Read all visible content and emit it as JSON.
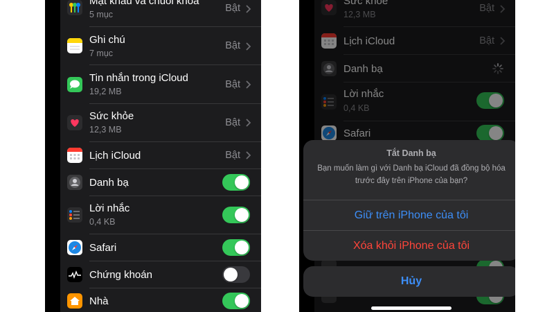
{
  "status_on_label": "Bật",
  "left_screen": {
    "rows": [
      {
        "title": "Mật khẩu và chuỗi khóa",
        "subtitle": "5 mục",
        "status": "Bật"
      },
      {
        "title": "Ghi chú",
        "subtitle": "7 mục",
        "status": "Bật"
      },
      {
        "title": "Tin nhắn trong iCloud",
        "subtitle": "19,2 MB",
        "status": "Bật"
      },
      {
        "title": "Sức khỏe",
        "subtitle": "12,3 MB",
        "status": "Bật"
      },
      {
        "title": "Lịch iCloud",
        "status": "Bật"
      },
      {
        "title": "Danh bạ",
        "toggle_on": true
      },
      {
        "title": "Lời nhắc",
        "subtitle": "0,4 KB",
        "toggle_on": true
      },
      {
        "title": "Safari",
        "toggle_on": true
      },
      {
        "title": "Chứng khoán",
        "toggle_on": false
      },
      {
        "title": "Nhà",
        "toggle_on": true
      }
    ]
  },
  "right_screen": {
    "rows": [
      {
        "title": "Sức khỏe",
        "subtitle": "12,3 MB",
        "status": "Bật"
      },
      {
        "title": "Lịch iCloud",
        "status": "Bật"
      },
      {
        "title": "Danh bạ",
        "loading": true
      },
      {
        "title": "Lời nhắc",
        "subtitle": "0,4 KB",
        "toggle_on": true
      },
      {
        "title": "Safari",
        "toggle_on": true
      }
    ],
    "action_sheet": {
      "title": "Tắt Danh bạ",
      "message": "Bạn muốn làm gì với Danh bạ iCloud đã đồng bộ hóa trước đây trên iPhone của bạn?",
      "keep_label": "Giữ trên iPhone của tôi",
      "delete_label": "Xóa khỏi iPhone của tôi",
      "cancel_label": "Hủy"
    }
  },
  "icons": {
    "passwords": "key-icon",
    "notes": "notes-icon",
    "messages": "messages-icon",
    "health": "heart-icon",
    "calendar": "calendar-icon",
    "contacts": "contacts-icon",
    "reminders": "reminders-icon",
    "safari": "compass-icon",
    "stocks": "stocks-icon",
    "home": "house-icon"
  },
  "colors": {
    "toggle_on": "#34c759",
    "toggle_off": "#39393d",
    "action_blue": "#3d8ef7",
    "destructive_red": "#ff453a",
    "row_background": "#1c1c1e",
    "secondary_text": "#8e8e93"
  }
}
